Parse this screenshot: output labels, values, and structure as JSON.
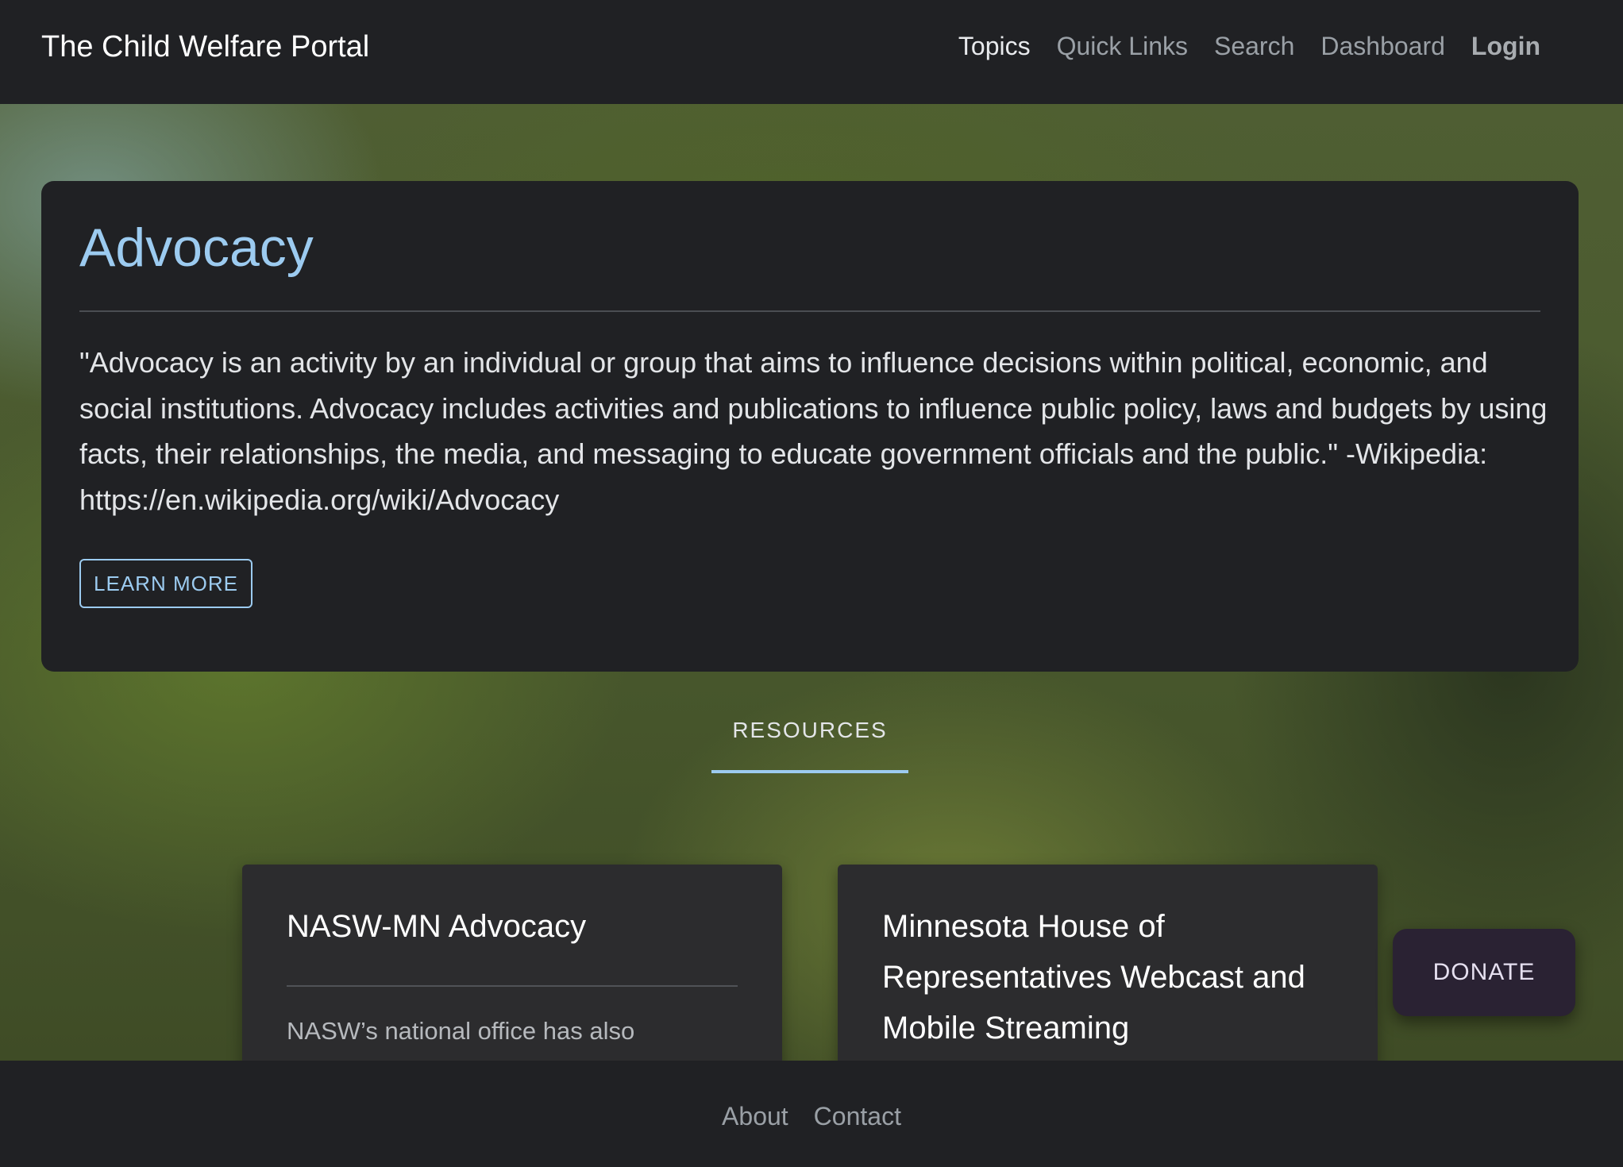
{
  "navbar": {
    "brand": "The Child Welfare Portal",
    "links": [
      "Topics",
      "Quick Links",
      "Search",
      "Dashboard",
      "Login"
    ]
  },
  "hero": {
    "title": "Advocacy",
    "text": "\"Advocacy is an activity by an individual or group that aims to influence decisions within political, economic, and social institutions. Advocacy includes activities and publications to influence public policy, laws and budgets by using facts, their relationships, the media, and messaging to educate government officials and the public.\" -Wikipedia: https://en.wikipedia.org/wiki/Advocacy",
    "button_label": "LEARN MORE"
  },
  "resources": {
    "tab_label": "RESOURCES",
    "cards": [
      {
        "title": "NASW-MN Advocacy",
        "text": "NASW’s national office has also"
      },
      {
        "title": "Minnesota House of Representatives Webcast and Mobile Streaming",
        "text": ""
      }
    ]
  },
  "donate": {
    "label": "DONATE"
  },
  "footer": {
    "links": [
      "About",
      "Contact"
    ]
  },
  "colors": {
    "accent": "#9ccbf0",
    "background": "#202124",
    "card": "#2c2c2e",
    "donate": "#2a2233"
  }
}
